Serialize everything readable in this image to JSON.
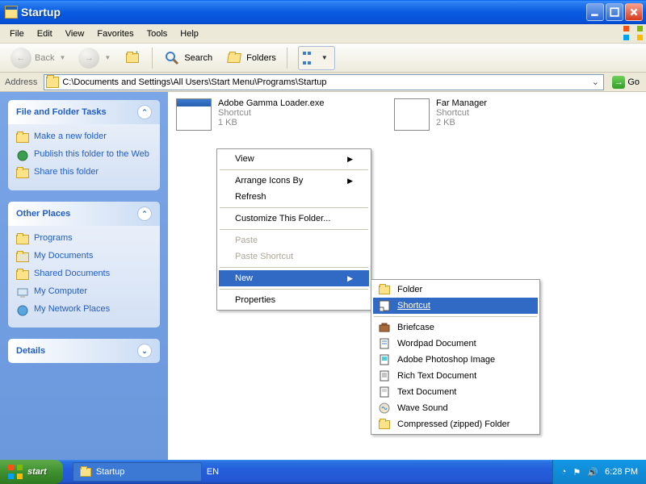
{
  "window": {
    "title": "Startup"
  },
  "menubar": {
    "items": [
      "File",
      "Edit",
      "View",
      "Favorites",
      "Tools",
      "Help"
    ]
  },
  "toolbar": {
    "back": "Back",
    "search": "Search",
    "folders": "Folders"
  },
  "address": {
    "label": "Address",
    "path": "C:\\Documents and Settings\\All Users\\Start Menu\\Programs\\Startup",
    "go": "Go"
  },
  "sidepanel": {
    "tasks_title": "File and Folder Tasks",
    "tasks": {
      "new_folder": "Make a new folder",
      "publish": "Publish this folder to the Web",
      "share": "Share this folder"
    },
    "places_title": "Other Places",
    "places": {
      "programs": "Programs",
      "mydocs": "My Documents",
      "shared": "Shared Documents",
      "mycomputer": "My Computer",
      "network": "My Network Places"
    },
    "details_title": "Details"
  },
  "files": {
    "f1": {
      "name": "Adobe Gamma Loader.exe",
      "type": "Shortcut",
      "size": "1 KB"
    },
    "f2": {
      "name": "Far Manager",
      "type": "Shortcut",
      "size": "2 KB"
    }
  },
  "context": {
    "view": "View",
    "arrange": "Arrange Icons By",
    "refresh": "Refresh",
    "customize": "Customize This Folder...",
    "paste": "Paste",
    "paste_shortcut": "Paste Shortcut",
    "new": "New",
    "properties": "Properties"
  },
  "submenu": {
    "folder": "Folder",
    "shortcut": "Shortcut",
    "briefcase": "Briefcase",
    "wordpad": "Wordpad Document",
    "photoshop": "Adobe Photoshop Image",
    "rtf": "Rich Text Document",
    "txt": "Text Document",
    "wave": "Wave Sound",
    "zip": "Compressed (zipped) Folder"
  },
  "taskbar": {
    "start": "start",
    "task1": "Startup",
    "lang": "EN",
    "time": "6:28 PM"
  }
}
